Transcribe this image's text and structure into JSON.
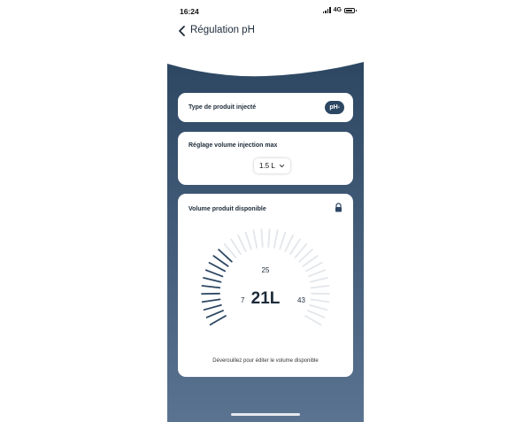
{
  "status_bar": {
    "time": "16:24",
    "network": "4G"
  },
  "header": {
    "title": "Régulation pH"
  },
  "product_card": {
    "label": "Type de produit injecté",
    "value": "pH-"
  },
  "volume_card": {
    "label": "Réglage volume injection max",
    "selected": "1.5 L"
  },
  "available_card": {
    "label": "Volume produit disponible",
    "gauge": {
      "value": "21L",
      "top_tick": "25",
      "min_label": "7",
      "max_label": "43",
      "fill_fraction": 0.33
    },
    "hint": "Déverouillez pour éditer le volume disponible"
  },
  "colors": {
    "background_top": "#2d4763",
    "background_bottom": "#5a7390",
    "accent": "#2d4763",
    "gauge_inactive": "#e3e6ea"
  }
}
